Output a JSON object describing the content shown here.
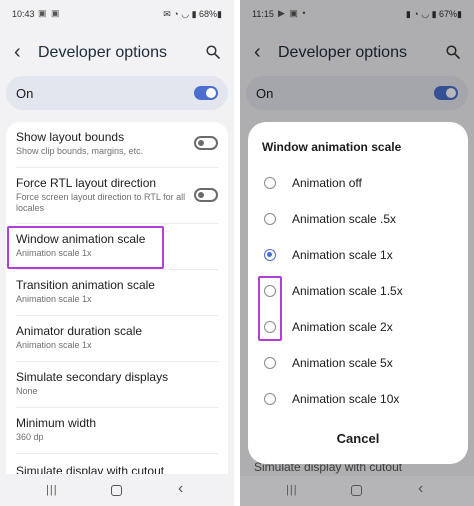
{
  "left": {
    "status": {
      "time": "10:43",
      "notifs": "▣ ▣",
      "right": "✉ ◔ ◡ ▮ 68%▮"
    },
    "appbar": {
      "title": "Developer options"
    },
    "master": {
      "label": "On"
    },
    "items": [
      {
        "title": "Show layout bounds",
        "sub": "Show clip bounds, margins, etc.",
        "toggle": "off"
      },
      {
        "title": "Force RTL layout direction",
        "sub": "Force screen layout direction to RTL for all locales",
        "toggle": "off"
      },
      {
        "title": "Window animation scale",
        "sub": "Animation scale 1x"
      },
      {
        "title": "Transition animation scale",
        "sub": "Animation scale 1x"
      },
      {
        "title": "Animator duration scale",
        "sub": "Animation scale 1x"
      },
      {
        "title": "Simulate secondary displays",
        "sub": "None"
      },
      {
        "title": "Minimum width",
        "sub": "360 dp"
      },
      {
        "title": "Simulate display with cutout",
        "sub": ""
      }
    ]
  },
  "right": {
    "status": {
      "time": "11:15",
      "notifs": "▶ ▣ •",
      "right": "▮ ◔ ◡ ▮ 67%▮"
    },
    "appbar": {
      "title": "Developer options"
    },
    "master": {
      "label": "On"
    },
    "dialog": {
      "title": "Window animation scale",
      "selected_index": 2,
      "options": [
        "Animation off",
        "Animation scale .5x",
        "Animation scale 1x",
        "Animation scale 1.5x",
        "Animation scale 2x",
        "Animation scale 5x",
        "Animation scale 10x"
      ],
      "cancel": "Cancel"
    },
    "peek_text": "Simulate display with cutout"
  },
  "colors": {
    "accent": "#4b6fd0",
    "highlight": "#b33ed6"
  }
}
